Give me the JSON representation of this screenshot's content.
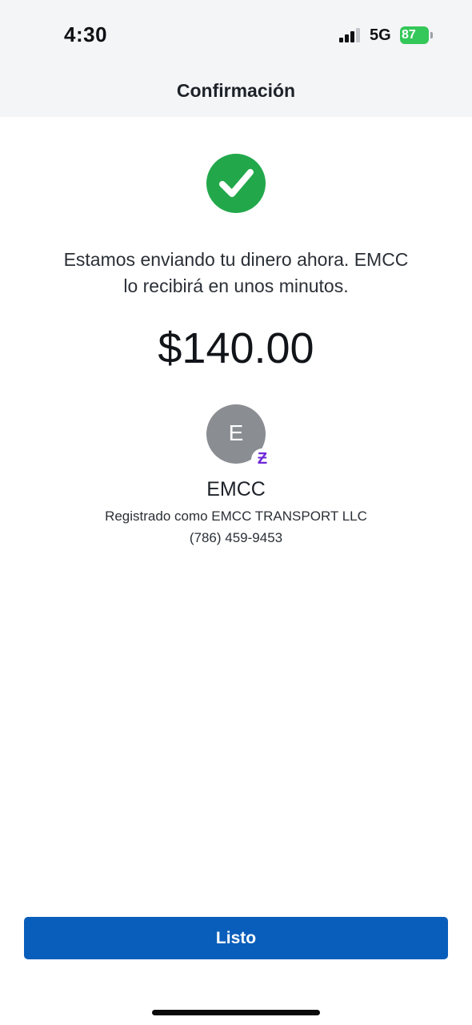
{
  "status_bar": {
    "time": "4:30",
    "network": "5G",
    "battery": "87",
    "signal_icon": "cellular-signal-icon",
    "battery_icon": "battery-charging-icon"
  },
  "nav": {
    "title": "Confirmación"
  },
  "confirmation": {
    "icon": "check-circle-icon",
    "message_line1": "Estamos enviando tu dinero ahora. EMCC",
    "message_line2": "lo recibirá en unos minutos.",
    "amount": "$140.00"
  },
  "recipient": {
    "initial": "E",
    "badge_glyph": "Ƶ",
    "badge_icon": "cash-app-icon",
    "name": "EMCC",
    "registered_as": "Registrado como EMCC TRANSPORT LLC",
    "phone": "(786) 459-9453"
  },
  "actions": {
    "done_label": "Listo"
  },
  "colors": {
    "accent": "#0a5ebb",
    "success": "#22a84a",
    "battery": "#34c759",
    "avatar": "#8a8d91",
    "badge": "#6d28d9"
  }
}
